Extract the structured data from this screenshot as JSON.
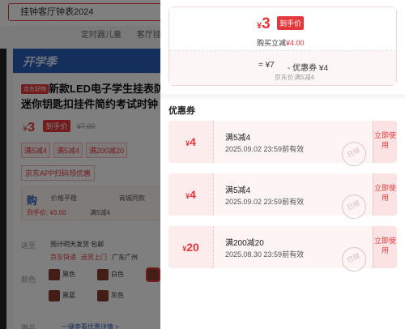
{
  "background": {
    "search_value": "挂钟客厅钟表2024",
    "hot_terms": [
      "定时器儿童",
      "客厅挂钟"
    ],
    "banner": "开学季",
    "title_tag": "京东好物",
    "product_title": "新款LED电子学生挂表防水迷你钥匙扣挂件简约考试时钟 钥",
    "price_symbol": "¥",
    "price": "3",
    "price_badge": "到手价",
    "orig_price": "¥7.00",
    "coupon_chips": [
      "满5减4",
      "满5减4",
      "满200减20"
    ],
    "app_promo": "京东APP扫码领优惠",
    "price_trend": {
      "item1": "价格平稳",
      "item2": "商城同款",
      "final_price": "到手价: ¥3.00",
      "coupon": "满5减4"
    },
    "labels": {
      "shipping": "送至",
      "color": "颜色",
      "plus": "赠品"
    },
    "ship_line1": "预计明天发货  包邮",
    "ship_express": "京东快递",
    "ship_door": "送货上门",
    "ship_area": "广东广州",
    "colors": [
      "黑色",
      "白色",
      "黑蓝",
      "灰色"
    ],
    "bottom_link": "一键查看优惠详情 >"
  },
  "drawer": {
    "summary": {
      "yen": "¥",
      "price": "3",
      "badge": "到手价",
      "sub_text": "购买立减",
      "sub_amount": "¥4.00",
      "eq_text": "= ¥7",
      "eq_label": "京东价",
      "minus_text": "- 优惠券 ¥4",
      "minus_label": "满5减4"
    },
    "coupon_section_title": "优惠券",
    "coupons": [
      {
        "yen": "¥",
        "amount": "4",
        "name": "满5减4",
        "validity": "2025.09.02 23:59前有效",
        "stamp": "已领",
        "button": "立即使用"
      },
      {
        "yen": "¥",
        "amount": "4",
        "name": "满5减4",
        "validity": "2025.09.02 23:59前有效",
        "stamp": "已领",
        "button": "立即使用"
      },
      {
        "yen": "¥",
        "amount": "20",
        "name": "满200减20",
        "validity": "2025.08.30 23:59前有效",
        "stamp": "已领",
        "button": "立即使用"
      }
    ]
  },
  "colors": {
    "accent": "#e4393c",
    "overlay": "rgba(0,0,0,0.5)"
  }
}
